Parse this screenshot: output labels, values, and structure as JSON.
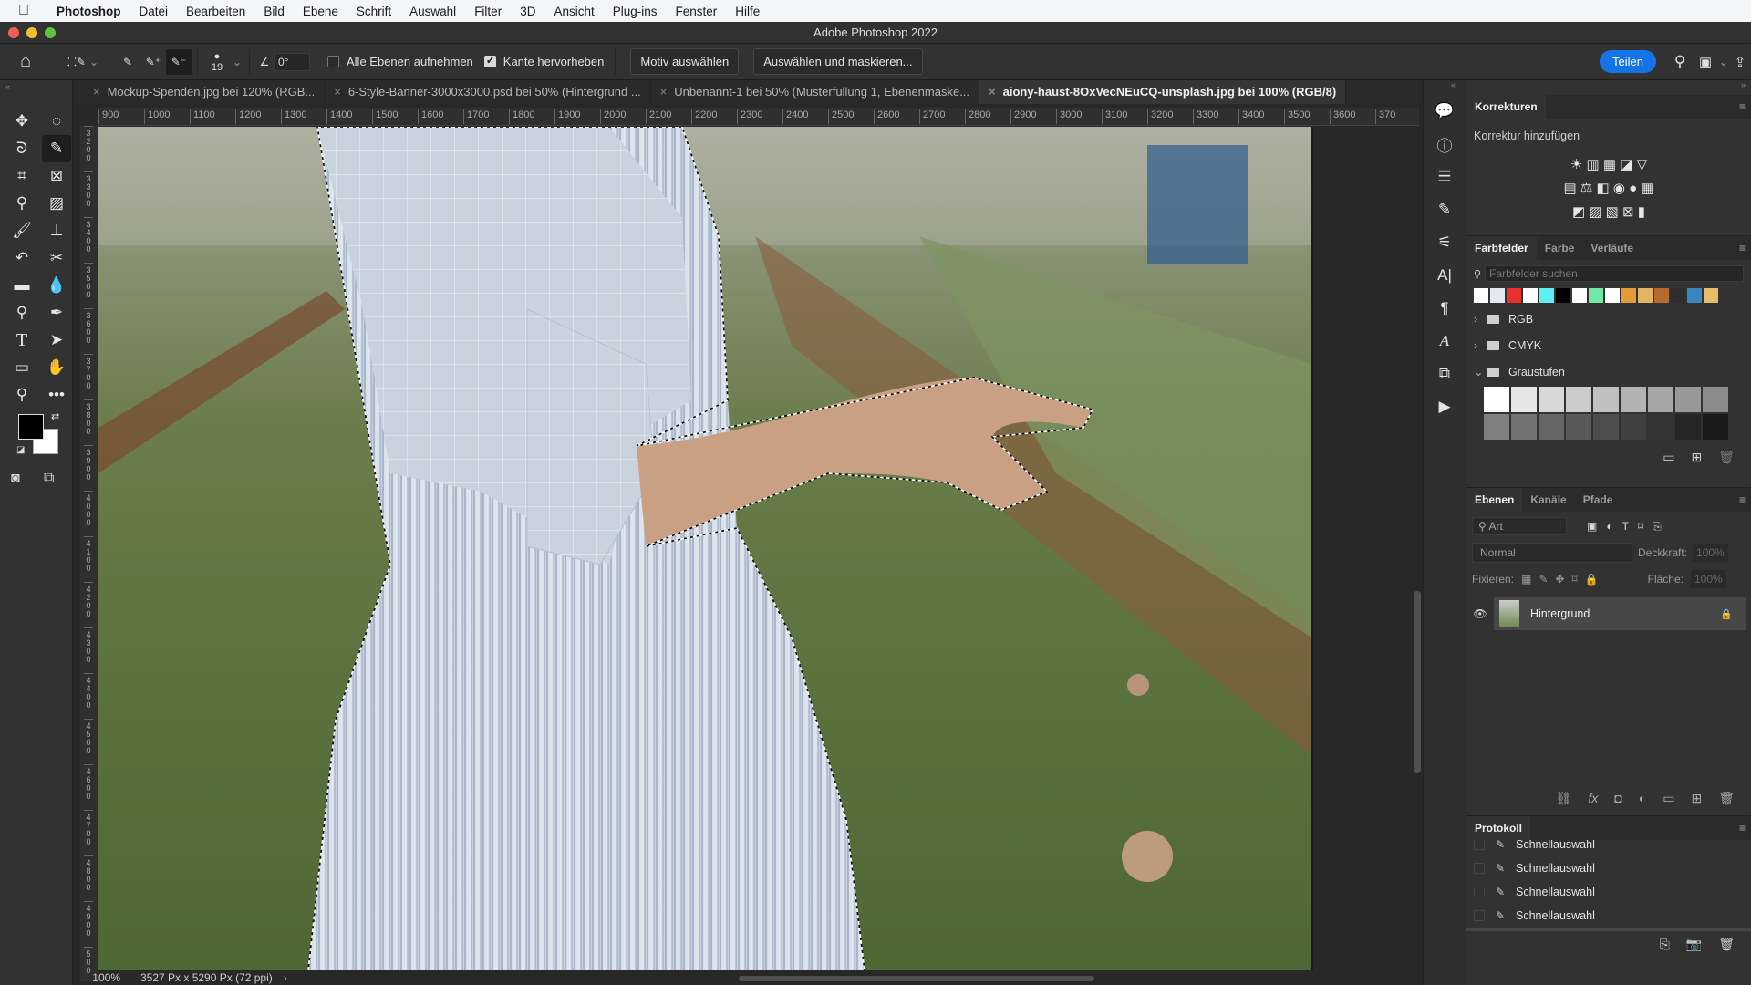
{
  "menubar": {
    "apple_icon": "",
    "app_name": "Photoshop",
    "items": [
      "Datei",
      "Bearbeiten",
      "Bild",
      "Ebene",
      "Schrift",
      "Auswahl",
      "Filter",
      "3D",
      "Ansicht",
      "Plug-ins",
      "Fenster",
      "Hilfe"
    ]
  },
  "window": {
    "title": "Adobe Photoshop 2022"
  },
  "options_bar": {
    "brush_size": "19",
    "angle": "0°",
    "sample_all_layers_label": "Alle Ebenen aufnehmen",
    "sample_all_layers_checked": false,
    "enhance_edge_label": "Kante hervorheben",
    "enhance_edge_checked": true,
    "select_subject_label": "Motiv auswählen",
    "select_and_mask_label": "Auswählen und maskieren...",
    "share_label": "Teilen"
  },
  "tabs": [
    {
      "label": "Mockup-Spenden.jpg bei 120% (RGB...",
      "active": false
    },
    {
      "label": "6-Style-Banner-3000x3000.psd bei 50% (Hintergrund ...",
      "active": false
    },
    {
      "label": "Unbenannt-1 bei 50% (Musterfüllung 1, Ebenenmaske...",
      "active": false
    },
    {
      "label": "aiony-haust-8OxVecNEuCQ-unsplash.jpg bei 100% (RGB/8)",
      "active": true
    }
  ],
  "ruler_h": [
    "900",
    "1000",
    "1100",
    "1200",
    "1300",
    "1400",
    "1500",
    "1600",
    "1700",
    "1800",
    "1900",
    "2000",
    "2100",
    "2200",
    "2300",
    "2400",
    "2500",
    "2600",
    "2700",
    "2800",
    "2900",
    "3000",
    "3100",
    "3200",
    "3300",
    "3400",
    "3500",
    "3600",
    "370"
  ],
  "ruler_v": [
    "3200",
    "3300",
    "3400",
    "3500",
    "3600",
    "3700",
    "3800",
    "3900",
    "4000",
    "4100",
    "4200",
    "4300",
    "4400",
    "4500",
    "4600",
    "4700",
    "4800",
    "4900",
    "500"
  ],
  "status": {
    "zoom": "100%",
    "doc_info": "3527 Px x 5290 Px (72 ppi)",
    "arrow": "›"
  },
  "colors": {
    "foreground": "#000000",
    "background": "#ffffff",
    "accent": "#1473e6"
  },
  "korrekturen": {
    "tab": "Korrekturen",
    "subtitle": "Korrektur hinzufügen",
    "icons_row1": [
      "☀",
      "▥",
      "▦",
      "◪",
      "▽"
    ],
    "icons_row2": [
      "▤",
      "⚖",
      "◧",
      "◉",
      "●",
      "▦"
    ],
    "icons_row3": [
      "◩",
      "▨",
      "▧",
      "⊠",
      "▮"
    ]
  },
  "swatches": {
    "tabs": [
      "Farbfelder",
      "Farbe",
      "Verläufe"
    ],
    "search_placeholder": "Farbfelder suchen",
    "recent": [
      "#ffffff",
      "#e6e8ef",
      "#e8322b",
      "#ffffff",
      "#5ef0f3",
      "#000000",
      "#ffffff",
      "#6fe8a8",
      "#ffffff",
      "#e39b36",
      "#e2b466",
      "#b56a2e",
      "#2e2e2e",
      "#3a87c0",
      "#e8bb6a"
    ],
    "folders": [
      {
        "name": "RGB",
        "expanded": false
      },
      {
        "name": "CMYK",
        "expanded": false
      },
      {
        "name": "Graustufen",
        "expanded": true
      }
    ],
    "grays": [
      "#ffffff",
      "#e6e6e6",
      "#d8d8d8",
      "#cccccc",
      "#c0c0c0",
      "#b3b3b3",
      "#a6a6a6",
      "#999999",
      "#8c8c8c",
      "#808080",
      "#737373",
      "#666666",
      "#595959",
      "#4d4d4d",
      "#404040",
      "#333333",
      "#262626",
      "#1a1a1a"
    ]
  },
  "layers": {
    "tabs": [
      "Ebenen",
      "Kanäle",
      "Pfade"
    ],
    "filter_label": "Art",
    "blend_mode": "Normal",
    "opacity_label": "Deckkraft:",
    "opacity": "100%",
    "lock_label": "Fixieren:",
    "fill_label": "Fläche:",
    "fill": "100%",
    "items": [
      {
        "name": "Hintergrund",
        "visible": true,
        "locked": true
      }
    ]
  },
  "history": {
    "tab": "Protokoll",
    "items": [
      "Schnellauswahl",
      "Schnellauswahl",
      "Schnellauswahl",
      "Schnellauswahl",
      "Schnellauswahl"
    ],
    "selected_index": 4
  }
}
